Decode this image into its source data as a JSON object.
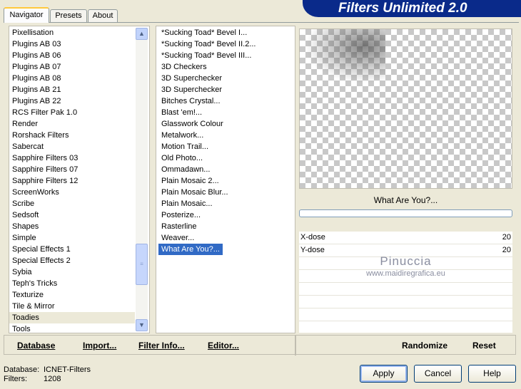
{
  "header": {
    "title": "Filters Unlimited 2.0"
  },
  "tabs": [
    {
      "label": "Navigator"
    },
    {
      "label": "Presets"
    },
    {
      "label": "About"
    }
  ],
  "categories": [
    "Pixellisation",
    "Plugins AB 03",
    "Plugins AB 06",
    "Plugins AB 07",
    "Plugins AB 08",
    "Plugins AB 21",
    "Plugins AB 22",
    "RCS Filter Pak 1.0",
    "Render",
    "Rorshack Filters",
    "Sabercat",
    "Sapphire Filters 03",
    "Sapphire Filters 07",
    "Sapphire Filters 12",
    "ScreenWorks",
    "Scribe",
    "Sedsoft",
    "Shapes",
    "Simple",
    "Special Effects 1",
    "Special Effects 2",
    "Sybia",
    "Teph's Tricks",
    "Texturize",
    "Tile & Mirror",
    "Toadies",
    "Tools"
  ],
  "selected_category": "Toadies",
  "filters": [
    "*Sucking Toad*  Bevel I...",
    "*Sucking Toad*  Bevel II.2...",
    "*Sucking Toad*  Bevel III...",
    "3D Checkers",
    "3D Superchecker",
    "3D Superchecker",
    "Bitches Crystal...",
    "Blast 'em!...",
    "Glasswork Colour",
    "Metalwork...",
    "Motion Trail...",
    "Old Photo...",
    "Ommadawn...",
    "Plain Mosaic 2...",
    "Plain Mosaic Blur...",
    "Plain Mosaic...",
    "Posterize...",
    "Rasterline",
    "Weaver...",
    "What Are You?..."
  ],
  "selected_filter": "What Are You?...",
  "preview": {
    "filter_name": "What Are You?..."
  },
  "params": [
    {
      "label": "X-dose",
      "value": "20"
    },
    {
      "label": "Y-dose",
      "value": "20"
    }
  ],
  "watermark": {
    "line1": "Pinuccia",
    "line2": "www.maidiregrafica.eu"
  },
  "toolbar": {
    "database": "Database",
    "import": "Import...",
    "filter_info": "Filter Info...",
    "editor": "Editor...",
    "randomize": "Randomize",
    "reset": "Reset"
  },
  "status": {
    "database_label": "Database:",
    "database_value": "ICNET-Filters",
    "filters_label": "Filters:",
    "filters_value": "1208"
  },
  "buttons": {
    "apply": "Apply",
    "cancel": "Cancel",
    "help": "Help"
  },
  "colors": {
    "banner": "#0a2a8a",
    "selection": "#316ac5",
    "dialog": "#ece9d8"
  },
  "icons": {
    "scroll_up": "chevron-up-icon",
    "scroll_down": "chevron-down-icon"
  }
}
